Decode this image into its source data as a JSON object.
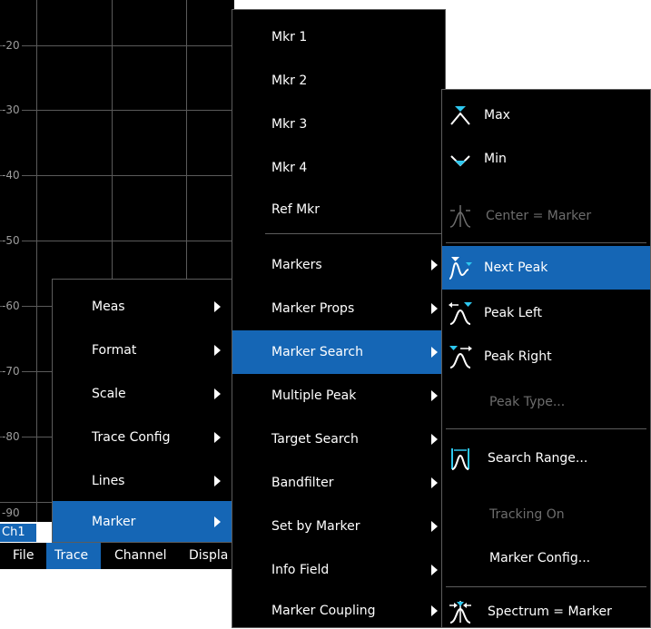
{
  "plot": {
    "y_labels": [
      "-20",
      "-30",
      "-40",
      "-50",
      "-60",
      "-70",
      "-80",
      "-90"
    ],
    "channel_tab": "Ch1"
  },
  "menubar": {
    "items": [
      {
        "label": "File",
        "active": false
      },
      {
        "label": "Trace",
        "active": true
      },
      {
        "label": "Channel",
        "active": false
      },
      {
        "label": "Displa",
        "active": false
      }
    ]
  },
  "trace_menu": {
    "items": [
      {
        "label": "Meas",
        "submenu": true
      },
      {
        "label": "Format",
        "submenu": true
      },
      {
        "label": "Scale",
        "submenu": true
      },
      {
        "label": "Trace Config",
        "submenu": true
      },
      {
        "label": "Lines",
        "submenu": true
      },
      {
        "label": "Marker",
        "submenu": true,
        "selected": true
      }
    ]
  },
  "marker_menu": {
    "items": [
      {
        "label": "Mkr 1"
      },
      {
        "label": "Mkr 2"
      },
      {
        "label": "Mkr 3"
      },
      {
        "label": "Mkr 4"
      },
      {
        "label": "Ref Mkr"
      },
      {
        "label": "Markers",
        "submenu": true
      },
      {
        "label": "Marker Props",
        "submenu": true
      },
      {
        "label": "Marker Search",
        "submenu": true,
        "selected": true
      },
      {
        "label": "Multiple Peak",
        "submenu": true
      },
      {
        "label": "Target Search",
        "submenu": true
      },
      {
        "label": "Bandfilter",
        "submenu": true
      },
      {
        "label": "Set by Marker",
        "submenu": true
      },
      {
        "label": "Info Field",
        "submenu": true
      },
      {
        "label": "Marker Coupling",
        "submenu": true
      }
    ]
  },
  "search_menu": {
    "items": [
      {
        "label": "Max",
        "icon": "max-search-icon"
      },
      {
        "label": "Min",
        "icon": "min-search-icon"
      },
      {
        "label": "Center = Marker",
        "icon": "center-marker-icon",
        "disabled": true
      },
      {
        "label": "Next Peak",
        "icon": "next-peak-icon",
        "selected": true
      },
      {
        "label": "Peak Left",
        "icon": "peak-left-icon"
      },
      {
        "label": "Peak Right",
        "icon": "peak-right-icon"
      },
      {
        "label": "Peak Type...",
        "disabled": true
      },
      {
        "label": "Search Range...",
        "icon": "search-range-icon"
      },
      {
        "label": "Tracking On",
        "disabled": true
      },
      {
        "label": "Marker Config..."
      },
      {
        "label": "Spectrum = Marker",
        "icon": "spectrum-marker-icon"
      }
    ]
  },
  "colors": {
    "selection": "#1566b5",
    "marker_cyan": "#2ec8f0",
    "disabled_text": "#6d6d6d",
    "menu_background": "#000000"
  }
}
